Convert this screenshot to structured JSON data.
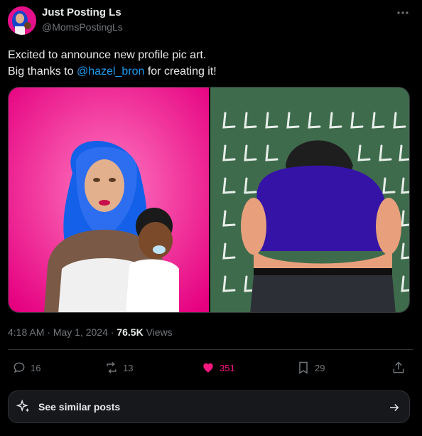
{
  "author": {
    "name": "Just Posting Ls",
    "handle": "@MomsPostingLs"
  },
  "post": {
    "line1": "Excited to announce new profile pic art.",
    "line2_prefix": "Big thanks to ",
    "mention": "@hazel_bron",
    "line2_suffix": " for creating it!"
  },
  "meta": {
    "time": "4:18 AM",
    "sep1": " · ",
    "date": "May 1, 2024",
    "sep2": " · ",
    "views_count": "76.5K",
    "views_label": " Views"
  },
  "actions": {
    "replies": "16",
    "reposts": "13",
    "likes": "351",
    "bookmarks": "29"
  },
  "similar": {
    "label": "See similar posts"
  },
  "colors": {
    "accent": "#1d9bf0",
    "like": "#f91880",
    "muted": "#71767b",
    "panel_left_bg": "#f0168f",
    "panel_right_bg": "#3f6b4d"
  },
  "icons": {
    "more": "more-dots-icon",
    "reply": "reply-icon",
    "repost": "repost-icon",
    "like": "heart-filled-icon",
    "bookmark": "bookmark-icon",
    "share": "share-icon",
    "sparkle": "sparkle-icon",
    "arrow": "arrow-right-icon"
  }
}
